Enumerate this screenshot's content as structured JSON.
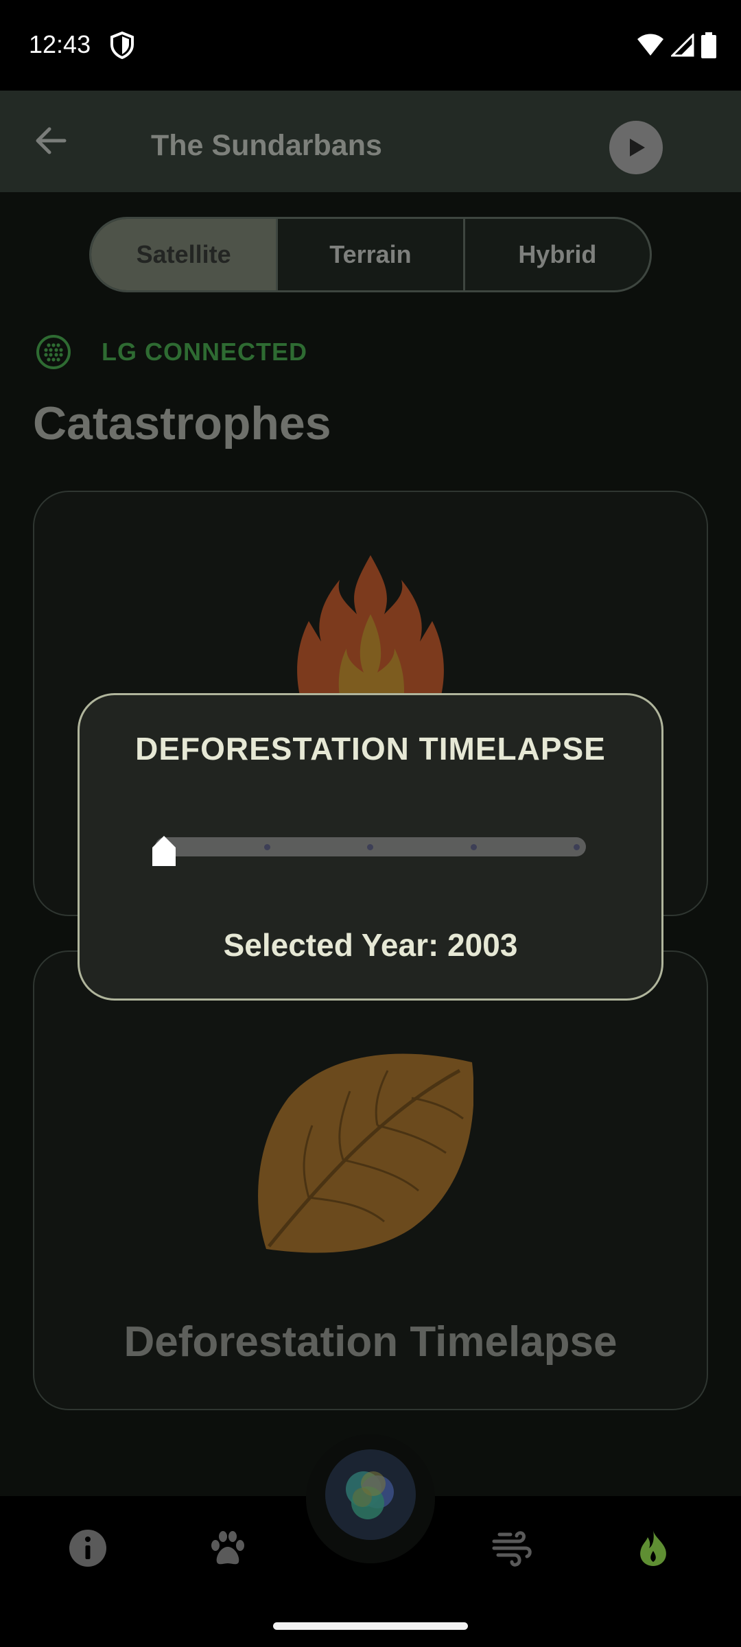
{
  "status_bar": {
    "time": "12:43"
  },
  "app_bar": {
    "title": "The Sundarbans"
  },
  "map_type": {
    "options": [
      "Satellite",
      "Terrain",
      "Hybrid"
    ],
    "selected": "Satellite"
  },
  "connection": {
    "label": "LG CONNECTED",
    "color": "#2e6b32"
  },
  "section": {
    "title": "Catastrophes"
  },
  "cards": [
    {
      "icon": "fire-icon"
    },
    {
      "icon": "leaf-icon",
      "title": "Deforestation Timelapse"
    }
  ],
  "dialog": {
    "title": "DEFORESTATION TIMELAPSE",
    "selected_year_label": "Selected Year: 2003",
    "slider_position": 0
  },
  "bottom_nav": {
    "items": [
      "info-icon",
      "paw-icon",
      "assistant-orb-icon",
      "wind-icon",
      "fire-icon"
    ],
    "active": "fire-icon",
    "active_color": "#5f8f33"
  }
}
